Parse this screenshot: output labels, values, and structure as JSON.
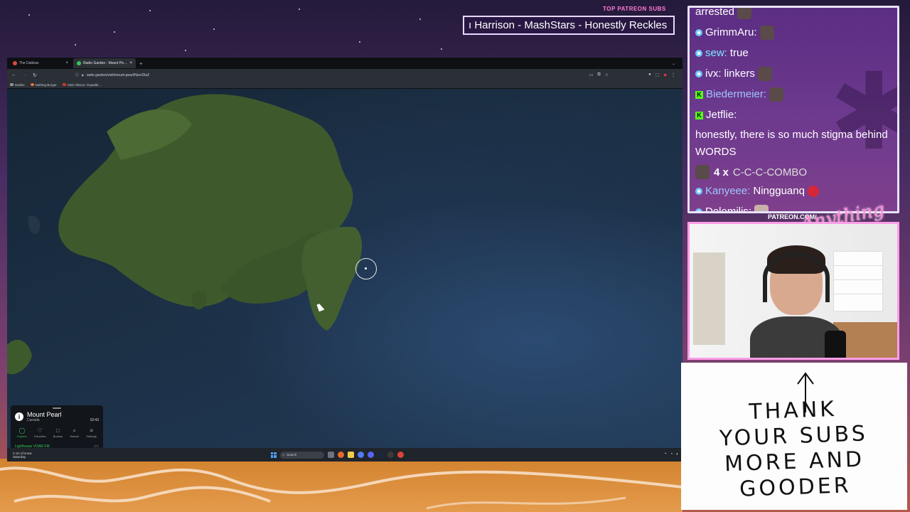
{
  "browser": {
    "tabs": [
      {
        "label": "The Dabban",
        "active": false,
        "favicon_color": "#d94c3d"
      },
      {
        "label": "Radio Garden - Mount Pe…",
        "active": true,
        "favicon_color": "#34c759"
      }
    ],
    "url": "radio.garden/visit/mount-pearl/NecrDlaZ",
    "bookmarks": [
      {
        "label": "Dailies",
        "color": "#8a8f98"
      },
      {
        "label": "Nothing Burger",
        "color": "#e07b39"
      },
      {
        "label": "Clair Obscur: Expediti…",
        "color": "#c0392b"
      }
    ]
  },
  "player": {
    "station_name": "Mount Pearl",
    "country": "Canada",
    "local_time": "10:43",
    "nav": [
      {
        "label": "Explore",
        "icon": "globe-icon",
        "glyph": "◯",
        "active": true
      },
      {
        "label": "Favorites",
        "icon": "heart-icon",
        "glyph": "♡",
        "active": false
      },
      {
        "label": "Browse",
        "icon": "map-icon",
        "glyph": "□",
        "active": false
      },
      {
        "label": "Search",
        "icon": "search-icon",
        "glyph": "⌕",
        "active": false
      },
      {
        "label": "Settings",
        "icon": "menu-icon",
        "glyph": "≡",
        "active": false
      }
    ],
    "now_playing": "Lighthouse VOAR FM",
    "now_playing_sub": "Loading from fastcastiu.com",
    "volume": 0.5
  },
  "taskbar": {
    "weather_line1": "2 cm of snow",
    "weather_line2": "Saturday",
    "search_placeholder": "Search"
  },
  "overlay": {
    "top_subs_label": "TOP PATREON SUBS",
    "ticker_text": "ı Harrison - MashStars - Honestly Reckles",
    "patreon_label": "PATREON.COM/",
    "brand_script": "Anything Else"
  },
  "chat": {
    "messages": [
      {
        "badge": "none",
        "user": "",
        "user_color": "white",
        "text": "arrested",
        "emote": true
      },
      {
        "badge": "circle",
        "user": "GrimmAru:",
        "user_color": "white",
        "text": "",
        "emote": true
      },
      {
        "badge": "circle",
        "user": "sew:",
        "user_color": "cyan",
        "text": "true",
        "emote": false
      },
      {
        "badge": "circle",
        "user": "ivx:",
        "user_color": "white",
        "text": "linkers",
        "emote": true
      },
      {
        "badge": "kick",
        "user": "Biedermeier:",
        "user_color": "blue",
        "text": "",
        "emote": true
      },
      {
        "badge": "kick",
        "user": "Jetflie:",
        "user_color": "white",
        "text": "honestly, there is so much stigma behind WORDS",
        "emote": false
      }
    ],
    "combo": {
      "count": "4 x",
      "text": "C-C-C-COMBO"
    },
    "messages_after": [
      {
        "badge": "circle",
        "user": "Kanyeee:",
        "user_color": "blue",
        "text": "Ningguanq",
        "emote": "red"
      },
      {
        "badge": "circle",
        "user": "Dolemilis:",
        "user_color": "white",
        "text": "",
        "emote": "stone"
      }
    ]
  },
  "whiteboard": {
    "lines": [
      "THANK",
      "YOUR SUBS",
      "MORE AND",
      "GOODER"
    ]
  }
}
